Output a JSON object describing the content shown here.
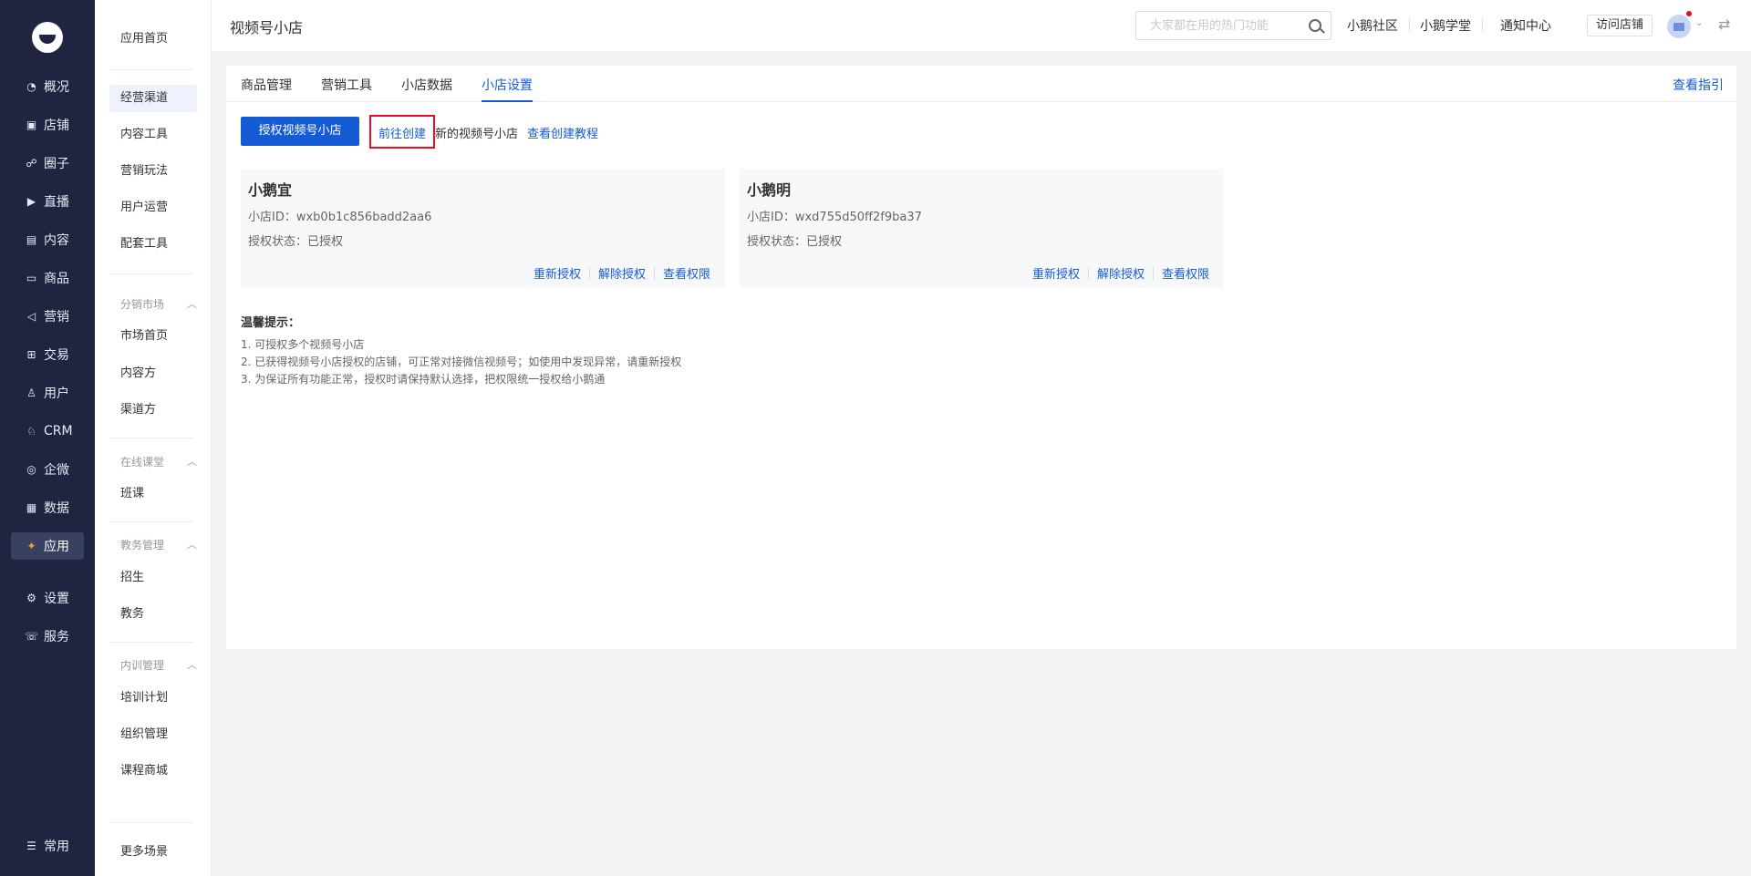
{
  "nav": {
    "items": [
      {
        "label": "概况",
        "icon": "overview-icon"
      },
      {
        "label": "店铺",
        "icon": "shop-icon"
      },
      {
        "label": "圈子",
        "icon": "circle-icon"
      },
      {
        "label": "直播",
        "icon": "live-icon"
      },
      {
        "label": "内容",
        "icon": "content-icon"
      },
      {
        "label": "商品",
        "icon": "goods-icon"
      },
      {
        "label": "营销",
        "icon": "marketing-icon"
      },
      {
        "label": "交易",
        "icon": "trade-icon"
      },
      {
        "label": "用户",
        "icon": "user-icon"
      },
      {
        "label": "CRM",
        "icon": "crm-icon"
      },
      {
        "label": "企微",
        "icon": "wecom-icon"
      },
      {
        "label": "数据",
        "icon": "data-icon"
      },
      {
        "label": "应用",
        "icon": "apps-icon"
      },
      {
        "label": "设置",
        "icon": "settings-icon"
      },
      {
        "label": "服务",
        "icon": "service-icon"
      }
    ],
    "bottom": {
      "label": "常用",
      "icon": "list-icon"
    }
  },
  "sub_nav": {
    "home": "应用首页",
    "items": [
      "经营渠道",
      "内容工具",
      "营销玩法",
      "用户运营",
      "配套工具"
    ],
    "group1": {
      "title": "分销市场",
      "items": [
        "市场首页",
        "内容方",
        "渠道方"
      ]
    },
    "group2": {
      "title": "在线课堂",
      "items": [
        "班课"
      ]
    },
    "group3": {
      "title": "教务管理",
      "items": [
        "招生",
        "教务"
      ]
    },
    "group4": {
      "title": "内训管理",
      "items": [
        "培训计划",
        "组织管理",
        "课程商城"
      ]
    },
    "more": "更多场景"
  },
  "header": {
    "title": "视频号小店",
    "search_placeholder": "大家都在用的热门功能",
    "links": [
      "小鹅社区",
      "小鹅学堂",
      "通知中心"
    ],
    "visit_shop": "访问店铺"
  },
  "tabs": {
    "items": [
      "商品管理",
      "营销工具",
      "小店数据",
      "小店设置"
    ],
    "active": "小店设置",
    "guide": "查看指引"
  },
  "actions": {
    "authorize": "授权视频号小店",
    "go_create": "前往创建",
    "create_suffix": "新的视频号小店",
    "tutorial": "查看创建教程"
  },
  "shops": [
    {
      "name": "小鹅宜",
      "id_label": "小店ID：",
      "id": "wxb0b1c856badd2aa6",
      "status_label": "授权状态：",
      "status": "已授权"
    },
    {
      "name": "小鹅明",
      "id_label": "小店ID：",
      "id": "wxd755d50ff2f9ba37",
      "status_label": "授权状态：",
      "status": "已授权"
    }
  ],
  "shop_actions": {
    "reauth": "重新授权",
    "revoke": "解除授权",
    "view": "查看权限"
  },
  "tips": {
    "title": "温馨提示：",
    "items": [
      "1. 可授权多个视频号小店",
      "2. 已获得视频号小店授权的店铺，可正常对接微信视频号；如使用中发现异常，请重新授权",
      "3. 为保证所有功能正常，授权时请保持默认选择，把权限统一授权给小鹅通"
    ]
  }
}
